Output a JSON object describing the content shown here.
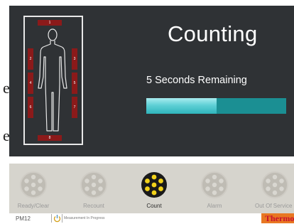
{
  "screen": {
    "title": "Counting",
    "remaining_text": "5 Seconds Remaining",
    "progress": 0.5,
    "edge_glyphs": [
      "e",
      "e"
    ]
  },
  "detectors": [
    "1",
    "2",
    "3",
    "4",
    "5",
    "6",
    "7",
    "8"
  ],
  "actions": [
    {
      "label": "Ready/Clear",
      "active": false
    },
    {
      "label": "Recount",
      "active": false
    },
    {
      "label": "Count",
      "active": true
    },
    {
      "label": "Alarm",
      "active": false
    },
    {
      "label": "Out Of Service",
      "active": false
    }
  ],
  "footer": {
    "instrument_id": "PM12",
    "status": "Measurement In Progress",
    "brand": "Thermo"
  },
  "colors": {
    "panel": "#2f3235",
    "detector": "#8b1a1a",
    "progress_track": "#1b8f93",
    "progress_fill": "#5fd0d6",
    "action_active": "#f2d21a",
    "brand_bg": "#e87722",
    "brand_text": "#c8102e"
  }
}
